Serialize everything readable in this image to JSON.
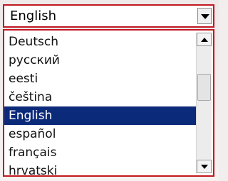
{
  "dropdown": {
    "selected_value": "English",
    "toggle_icon": "chevron-down-icon"
  },
  "list": {
    "items": [
      {
        "label": "Deutsch",
        "selected": false
      },
      {
        "label": "русский",
        "selected": false
      },
      {
        "label": "eesti",
        "selected": false
      },
      {
        "label": "čeština",
        "selected": false
      },
      {
        "label": "English",
        "selected": true
      },
      {
        "label": "español",
        "selected": false
      },
      {
        "label": "français",
        "selected": false
      },
      {
        "label": "hrvatski",
        "selected": false
      }
    ]
  },
  "scrollbar": {
    "up_icon": "arrow-up-icon",
    "down_icon": "arrow-down-icon"
  },
  "colors": {
    "border_accent": "#c01820",
    "selection_background": "#0c2a7a",
    "selection_text": "#ffffff"
  }
}
